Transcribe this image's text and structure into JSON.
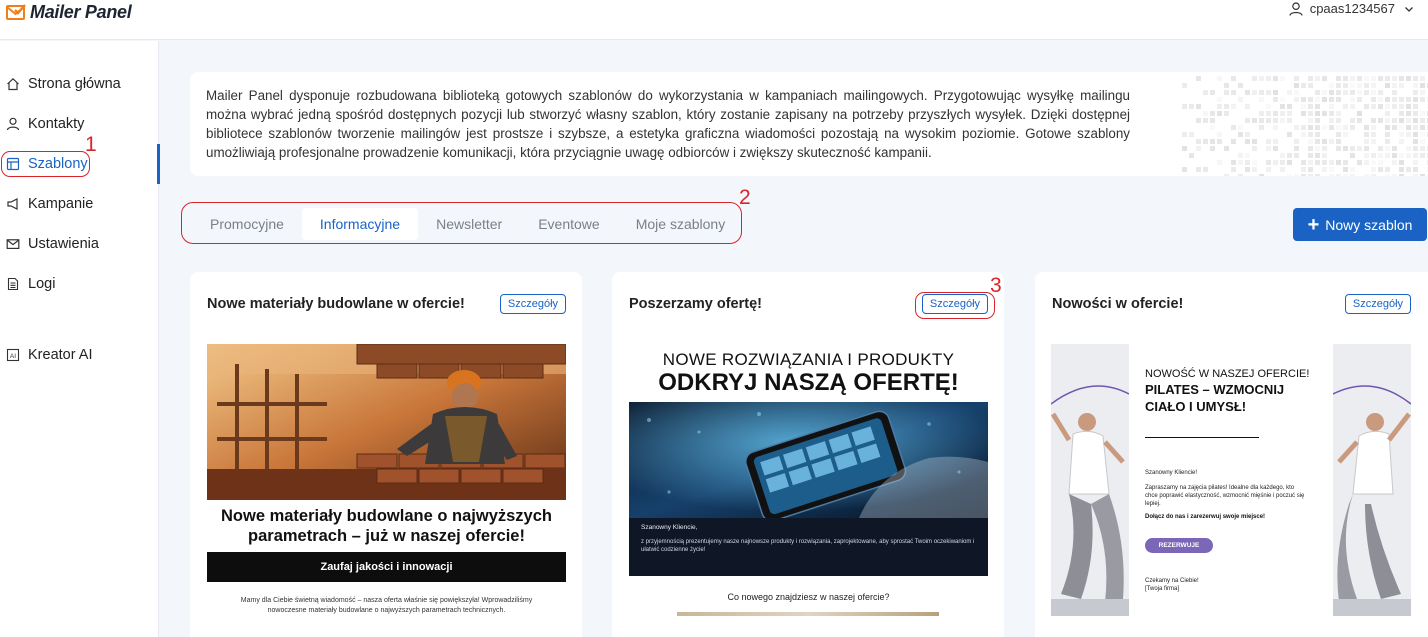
{
  "header": {
    "logo_text": "Mailer Panel",
    "username": "cpaas1234567"
  },
  "sidebar": {
    "items": [
      {
        "label": "Strona główna",
        "icon": "home-icon"
      },
      {
        "label": "Kontakty",
        "icon": "person-icon"
      },
      {
        "label": "Szablony",
        "icon": "template-icon",
        "active": true
      },
      {
        "label": "Kampanie",
        "icon": "megaphone-icon"
      },
      {
        "label": "Ustawienia",
        "icon": "envelope-icon"
      },
      {
        "label": "Logi",
        "icon": "log-icon"
      },
      {
        "label": "Kreator AI",
        "icon": "ai-icon"
      }
    ]
  },
  "annotations": [
    "1",
    "2",
    "3"
  ],
  "info": {
    "text": "Mailer Panel dysponuje rozbudowana biblioteką gotowych szablonów do wykorzystania w kampaniach mailingowych. Przygotowując wysyłkę mailingu można wybrać jedną spośród dostępnych pozycji lub stworzyć własny szablon, który zostanie zapisany na potrzeby przyszłych wysyłek. Dzięki dostępnej bibliotece szablonów tworzenie mailingów jest prostsze i szybsze, a estetyka graficzna wiadomości pozostają na wysokim poziomie. Gotowe szablony umożliwiają profesjonalne prowadzenie komunikacji, która przyciągnie uwagę odbiorców i zwiększy skuteczność kampanii."
  },
  "tabs": [
    {
      "label": "Promocyjne"
    },
    {
      "label": "Informacyjne",
      "active": true
    },
    {
      "label": "Newsletter"
    },
    {
      "label": "Eventowe"
    },
    {
      "label": "Moje szablony"
    }
  ],
  "new_button": {
    "label": "Nowy szablon"
  },
  "cards": [
    {
      "title": "Nowe materiały budowlane w ofercie!",
      "details_label": "Szczegóły",
      "preview": {
        "headline": "Nowe materiały budowlane o najwyższych parametrach – już w naszej ofercie!",
        "banner": "Zaufaj jakości i innowacji",
        "body": "Mamy dla Ciebie świetną wiadomość – nasza oferta właśnie się powiększyła! Wprowadziliśmy nowoczesne materiały budowlane o najwyższych parametrach technicznych."
      }
    },
    {
      "title": "Poszerzamy ofertę!",
      "details_label": "Szczegóły",
      "preview": {
        "line1": "NOWE ROZWIĄZANIA I PRODUKTY",
        "line2": "ODKRYJ NASZĄ OFERTĘ!",
        "greeting": "Szanowny Kliencie,",
        "body": "z przyjemnością prezentujemy nasze najnowsze produkty i rozwiązania, zaprojektowane, aby sprostać Twoim oczekiwaniom i ułatwić codzienne życie!",
        "footer": "Co nowego znajdziesz w naszej ofercie?"
      }
    },
    {
      "title": "Nowości w ofercie!",
      "details_label": "Szczegóły",
      "preview": {
        "line1": "NOWOŚĆ W NASZEJ OFERCIE!",
        "line2a": "PILATES",
        "line2b": " – WZMOCNIJ",
        "line3": "CIAŁO I UMYSŁ!",
        "greeting": "Szanowny Kliencie!",
        "body": "Zapraszamy na zajęcia pilates! Idealne dla każdego, kto chce poprawić elastyczność, wzmocnić mięśnie i poczuć się lepiej.",
        "cta_text": "Dołącz do nas i zarezerwuj swoje miejsce!",
        "button": "REZERWUJE",
        "sign1": "Czekamy na Ciebie!",
        "sign2": "[Twoja firma]"
      }
    }
  ],
  "colors": {
    "accent": "#1a63c5",
    "annotation": "#d9242b",
    "logo_orange": "#f07e1b",
    "reserve_button": "#7b66b8"
  }
}
